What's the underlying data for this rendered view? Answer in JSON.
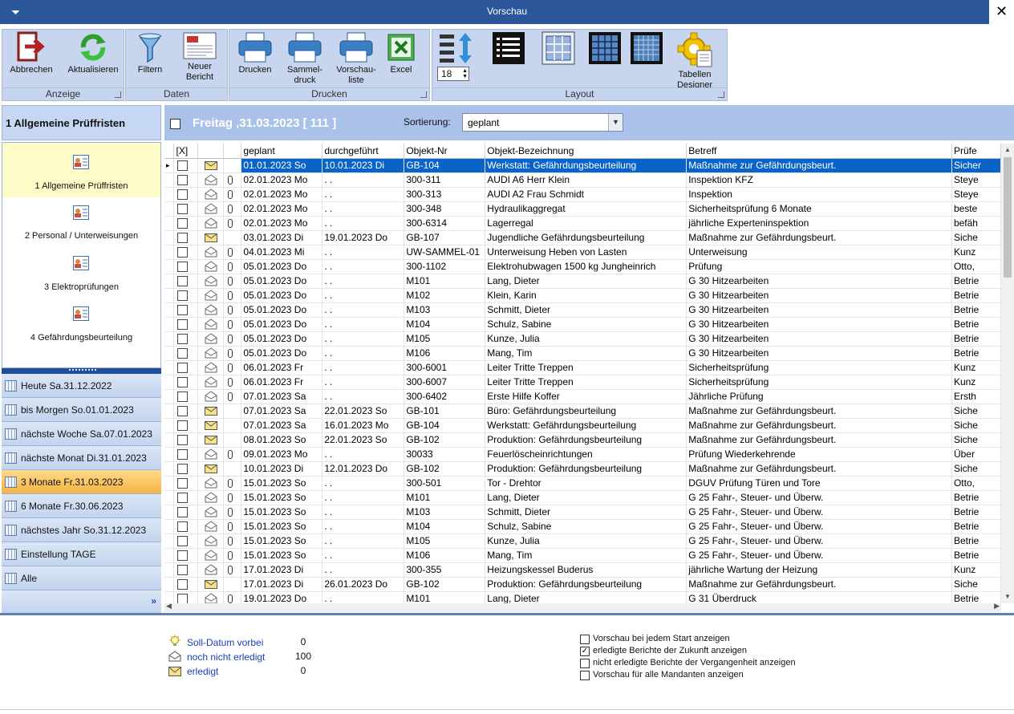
{
  "window": {
    "title": "Vorschau",
    "close": "✕",
    "menu": "⏷"
  },
  "ribbon": {
    "anzeige": {
      "label": "Anzeige",
      "abbrechen": "Abbrechen",
      "aktualisieren": "Aktualisieren"
    },
    "daten": {
      "label": "Daten",
      "filtern": "Filtern",
      "neuer_bericht_1": "Neuer",
      "neuer_bericht_2": "Bericht"
    },
    "drucken": {
      "label": "Drucken",
      "drucken": "Drucken",
      "sammel_1": "Sammel-",
      "sammel_2": "druck",
      "vorschau_1": "Vorschau-",
      "vorschau_2": "liste",
      "excel": "Excel"
    },
    "layout": {
      "label": "Layout",
      "font_size": "18",
      "tabellen_1": "Tabellen",
      "tabellen_2": "Designer"
    }
  },
  "sidebar": {
    "header": "1 Allgemeine Prüffristen",
    "nav_items": [
      {
        "label": "1 Allgemeine Prüffristen"
      },
      {
        "label": "2 Personal / Unterweisungen"
      },
      {
        "label": "3 Elektroprüfungen"
      },
      {
        "label": "4 Gefährdungsbeurteilung"
      }
    ],
    "periods": [
      {
        "label": "Heute Sa.31.12.2022"
      },
      {
        "label": "bis Morgen So.01.01.2023"
      },
      {
        "label": "nächste Woche Sa.07.01.2023"
      },
      {
        "label": "nächste Monat Di.31.01.2023"
      },
      {
        "label": "3 Monate Fr.31.03.2023"
      },
      {
        "label": "6 Monate Fr.30.06.2023"
      },
      {
        "label": "nächstes Jahr So.31.12.2023"
      },
      {
        "label": "Einstellung TAGE"
      },
      {
        "label": "Alle"
      }
    ],
    "more": "»"
  },
  "list_header": {
    "title": "Freitag ,31.03.2023  [ 111 ]",
    "sort_label": "Sortierung:",
    "sort_value": "geplant"
  },
  "table": {
    "columns": [
      "[X]",
      "",
      "",
      "geplant",
      "durchgeführt",
      "Objekt-Nr",
      "Objekt-Bezeichnung",
      "Betreff",
      "Prüfe"
    ],
    "rows": [
      [
        "mail",
        false,
        "01.01.2023 So",
        "10.01.2023 Di",
        "GB-104",
        "Werkstatt: Gefährdungsbeurteilung",
        "Maßnahme zur Gefährdungsbeurt.",
        "Sicher"
      ],
      [
        "open",
        true,
        "02.01.2023 Mo",
        " .  .",
        "300-311",
        "AUDI A6 Herr Klein",
        "Inspektion KFZ",
        "Steye"
      ],
      [
        "open",
        true,
        "02.01.2023 Mo",
        " .  .",
        "300-313",
        "AUDI A2 Frau Schmidt",
        "Inspektion",
        "Steye"
      ],
      [
        "open",
        true,
        "02.01.2023 Mo",
        " .  .",
        "300-348",
        "Hydraulikaggregat",
        "Sicherheitsprüfung 6 Monate",
        "beste"
      ],
      [
        "open",
        true,
        "02.01.2023 Mo",
        " .  .",
        "300-6314",
        "Lagerregal",
        "jährliche Experteninspektion",
        "befäh"
      ],
      [
        "mail",
        false,
        "03.01.2023 Di",
        "19.01.2023 Do",
        "GB-107",
        "Jugendliche Gefährdungsbeurteilung",
        "Maßnahme zur Gefährdungsbeurt.",
        "Siche"
      ],
      [
        "open",
        true,
        "04.01.2023 Mi",
        " .  .",
        "UW-SAMMEL-01",
        "Unterweisung Heben von Lasten",
        "Unterweisung",
        "Kunz"
      ],
      [
        "open",
        true,
        "05.01.2023 Do",
        " .  .",
        "300-1102",
        "Elektrohubwagen 1500 kg  Jungheinrich",
        "Prüfung",
        "Otto,"
      ],
      [
        "open",
        true,
        "05.01.2023 Do",
        " .  .",
        "M101",
        "Lang, Dieter",
        "G 30 Hitzearbeiten",
        "Betrie"
      ],
      [
        "open",
        true,
        "05.01.2023 Do",
        " .  .",
        "M102",
        "Klein, Karin",
        "G 30 Hitzearbeiten",
        "Betrie"
      ],
      [
        "open",
        true,
        "05.01.2023 Do",
        " .  .",
        "M103",
        "Schmitt, Dieter",
        "G 30 Hitzearbeiten",
        "Betrie"
      ],
      [
        "open",
        true,
        "05.01.2023 Do",
        " .  .",
        "M104",
        "Schulz, Sabine",
        "G 30 Hitzearbeiten",
        "Betrie"
      ],
      [
        "open",
        true,
        "05.01.2023 Do",
        " .  .",
        "M105",
        "Kunze, Julia",
        "G 30 Hitzearbeiten",
        "Betrie"
      ],
      [
        "open",
        true,
        "05.01.2023 Do",
        " .  .",
        "M106",
        "Mang, Tim",
        "G 30 Hitzearbeiten",
        "Betrie"
      ],
      [
        "open",
        true,
        "06.01.2023 Fr",
        " .  .",
        "300-6001",
        "Leiter Tritte Treppen",
        "Sicherheitsprüfung",
        "Kunz"
      ],
      [
        "open",
        true,
        "06.01.2023 Fr",
        " .  .",
        "300-6007",
        "Leiter Tritte Treppen",
        "Sicherheitsprüfung",
        "Kunz"
      ],
      [
        "open",
        true,
        "07.01.2023 Sa",
        " .  .",
        "300-6402",
        "Erste Hilfe Koffer",
        "Jährliche Prüfung",
        "Ersth"
      ],
      [
        "mail",
        false,
        "07.01.2023 Sa",
        "22.01.2023 So",
        "GB-101",
        "Büro: Gefährdungsbeurteilung",
        "Maßnahme zur Gefährdungsbeurt.",
        "Siche"
      ],
      [
        "mail",
        false,
        "07.01.2023 Sa",
        "16.01.2023 Mo",
        "GB-104",
        "Werkstatt: Gefährdungsbeurteilung",
        "Maßnahme zur Gefährdungsbeurt.",
        "Siche"
      ],
      [
        "mail",
        false,
        "08.01.2023 So",
        "22.01.2023 So",
        "GB-102",
        "Produktion: Gefährdungsbeurteilung",
        "Maßnahme zur Gefährdungsbeurt.",
        "Siche"
      ],
      [
        "open",
        true,
        "09.01.2023 Mo",
        " .  .",
        "30033",
        "Feuerlöscheinrichtungen",
        "Prüfung Wiederkehrende",
        "Über"
      ],
      [
        "mail",
        false,
        "10.01.2023 Di",
        "12.01.2023 Do",
        "GB-102",
        "Produktion: Gefährdungsbeurteilung",
        "Maßnahme zur Gefährdungsbeurt.",
        "Siche"
      ],
      [
        "open",
        true,
        "15.01.2023 So",
        " .  .",
        "300-501",
        "Tor - Drehtor",
        "DGUV Prüfung Türen und Tore",
        "Otto,"
      ],
      [
        "open",
        true,
        "15.01.2023 So",
        " .  .",
        "M101",
        "Lang, Dieter",
        "G 25 Fahr-, Steuer- und Überw.",
        "Betrie"
      ],
      [
        "open",
        true,
        "15.01.2023 So",
        " .  .",
        "M103",
        "Schmitt, Dieter",
        "G 25 Fahr-, Steuer- und Überw.",
        "Betrie"
      ],
      [
        "open",
        true,
        "15.01.2023 So",
        " .  .",
        "M104",
        "Schulz, Sabine",
        "G 25 Fahr-, Steuer- und Überw.",
        "Betrie"
      ],
      [
        "open",
        true,
        "15.01.2023 So",
        " .  .",
        "M105",
        "Kunze, Julia",
        "G 25 Fahr-, Steuer- und Überw.",
        "Betrie"
      ],
      [
        "open",
        true,
        "15.01.2023 So",
        " .  .",
        "M106",
        "Mang, Tim",
        "G 25 Fahr-, Steuer- und Überw.",
        "Betrie"
      ],
      [
        "open",
        true,
        "17.01.2023 Di",
        " .  .",
        "300-355",
        "Heizungskessel Buderus",
        "jährliche Wartung der Heizung",
        "Kunz"
      ],
      [
        "mail",
        false,
        "17.01.2023 Di",
        "26.01.2023 Do",
        "GB-102",
        "Produktion: Gefährdungsbeurteilung",
        "Maßnahme zur Gefährdungsbeurt.",
        "Siche"
      ],
      [
        "open",
        true,
        "19.01.2023 Do",
        " .  .",
        "M101",
        "Lang, Dieter",
        "G 31 Überdruck",
        "Betrie"
      ]
    ]
  },
  "legend": [
    {
      "label": "Soll-Datum vorbei",
      "count": "0"
    },
    {
      "label": "noch nicht erledigt",
      "count": "100"
    },
    {
      "label": "erledigt",
      "count": "0"
    }
  ],
  "options": [
    {
      "label": "Vorschau bei jedem Start anzeigen",
      "checked": false
    },
    {
      "label": "erledigte Berichte der Zukunft anzeigen",
      "checked": true
    },
    {
      "label": "nicht erledigte Berichte der Vergangenheit anzeigen",
      "checked": false
    },
    {
      "label": "Vorschau für alle Mandanten anzeigen",
      "checked": false
    }
  ],
  "colors": {
    "title_bar": "#2b579a",
    "ribbon_group": "#c7d6ee",
    "selected_row": "#0a64c8",
    "active_period": "#f5b444",
    "active_nav": "#fdfbc7"
  }
}
